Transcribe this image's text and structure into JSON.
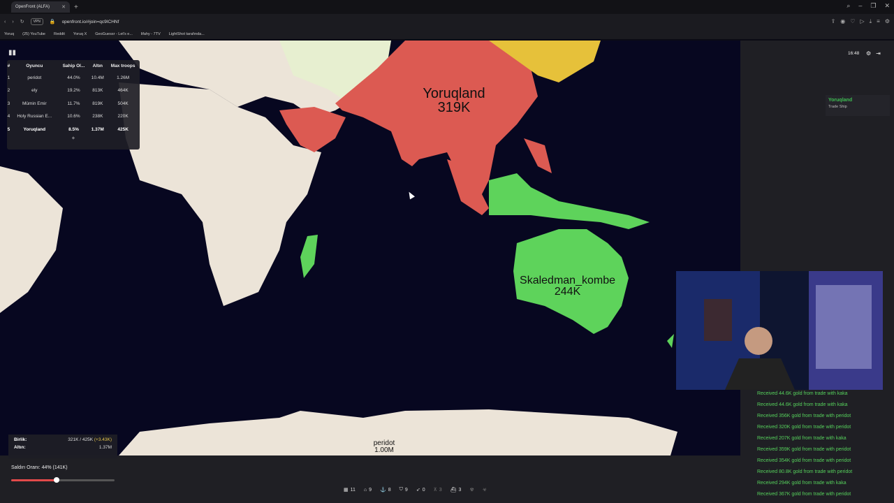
{
  "browser": {
    "tab_title": "OpenFront (ALFA)",
    "url": "openfront.io/#join=qc9ICHNf",
    "vpn_label": "VPN",
    "bookmarks": [
      "Yoruq",
      "(25) YouTube",
      "Reddit",
      "Yoruq X",
      "GeoGuessr - Let's e...",
      "lifahy - 7TV",
      "LightShot tarafında..."
    ]
  },
  "leaderboard": {
    "headers": [
      "#",
      "Oyuncu",
      "Sahip Ol...",
      "Altın",
      "Max troops"
    ],
    "rows": [
      {
        "rank": "1",
        "player": "peridot",
        "owned": "44.0%",
        "gold": "10.4M",
        "troops": "1.26M"
      },
      {
        "rank": "2",
        "player": "ely",
        "owned": "19.2%",
        "gold": "813K",
        "troops": "464K"
      },
      {
        "rank": "3",
        "player": "Mümin Emir",
        "owned": "11.7%",
        "gold": "819K",
        "troops": "504K"
      },
      {
        "rank": "4",
        "player": "Holy Russian E...",
        "owned": "10.6%",
        "gold": "238K",
        "troops": "220K"
      },
      {
        "rank": "5",
        "player": "Yoruqland",
        "owned": "8.5%",
        "gold": "1.37M",
        "troops": "425K"
      }
    ],
    "expand_label": "+"
  },
  "map_labels": {
    "yoruqland_name": "Yoruqland",
    "yoruqland_troops": "319K",
    "skaledman_name": "Skaledman_kombe",
    "skaledman_troops": "244K",
    "peridot_name": "peridot",
    "peridot_troops": "1.00M"
  },
  "hud": {
    "time": "16:48",
    "event_name": "Yoruqland",
    "event_sub": "Trade Ship"
  },
  "log": [
    "Received 44.6K gold from trade with kaka",
    "Received 44.6K gold from trade with kaka",
    "Received 356K gold from trade with peridot",
    "Received 320K gold from trade with peridot",
    "Received 207K gold from trade with kaka",
    "Received 359K gold from trade with peridot",
    "Received 354K gold from trade with peridot",
    "Received 80.8K gold from trade with peridot",
    "Received 294K gold from trade with kaka",
    "Received 367K gold from trade with peridot"
  ],
  "stats": {
    "troops_label": "Birlik:",
    "troops_value": "321K / 425K",
    "troops_gain": "(+3.43K)",
    "gold_label": "Altın:",
    "gold_value": "1.37M"
  },
  "attack": {
    "label": "Saldırı Oranı: 44% (141K)",
    "ratio": 0.44
  },
  "buildbar": [
    {
      "icon": "city-icon",
      "count": "11"
    },
    {
      "icon": "factory-icon",
      "count": "9"
    },
    {
      "icon": "port-icon",
      "count": "8"
    },
    {
      "icon": "defense-icon",
      "count": "9"
    },
    {
      "icon": "missile-icon",
      "count": "0"
    },
    {
      "icon": "sam-icon",
      "count": "3"
    },
    {
      "icon": "warship-icon",
      "count": "3"
    },
    {
      "icon": "atom-bomb-icon",
      "count": ""
    },
    {
      "icon": "hydrogen-bomb-icon",
      "count": ""
    }
  ],
  "colors": {
    "yoruqland": "#dc5a52",
    "skaledman": "#5ed35b",
    "land": "#ece4d8",
    "ocean": "#070720",
    "log_text": "#56d15c"
  }
}
